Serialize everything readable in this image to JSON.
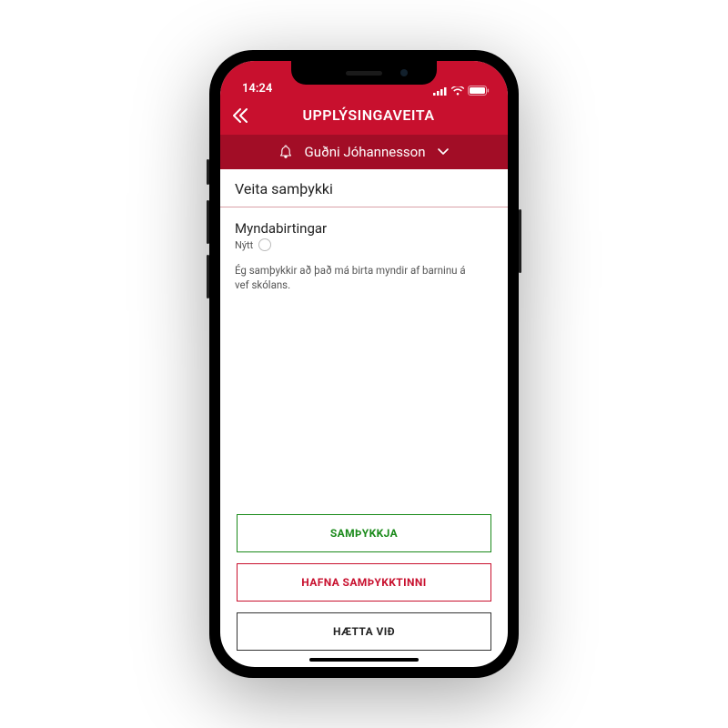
{
  "status": {
    "time": "14:24"
  },
  "header": {
    "title": "UPPLÝSINGAVEITA"
  },
  "userbar": {
    "name": "Guðni Jóhannesson"
  },
  "section": {
    "title": "Veita samþykki"
  },
  "consent": {
    "heading": "Myndabirtingar",
    "status_label": "Nýtt",
    "description": "Ég samþykkir að það má birta myndir af barninu á vef skólans."
  },
  "buttons": {
    "approve": "SAMÞYKKJA",
    "reject": "HAFNA SAMÞYKKTINNI",
    "cancel": "HÆTTA VIÐ"
  }
}
